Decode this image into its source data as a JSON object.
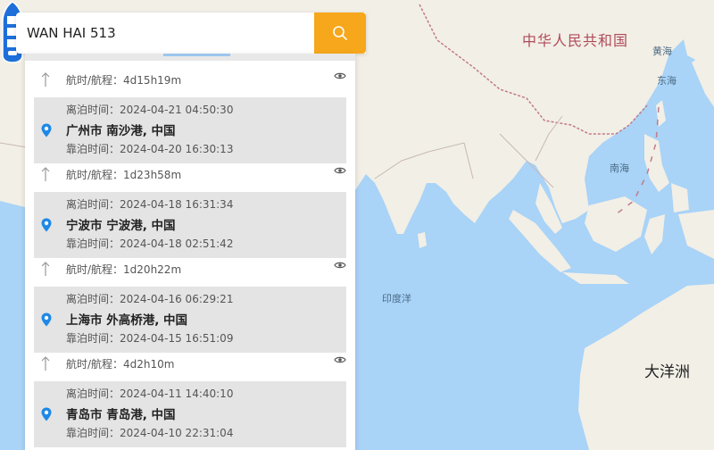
{
  "search": {
    "value": "WAN HAI 513"
  },
  "map": {
    "labels": {
      "country": "中华人民共和国",
      "yellow_sea": "黄海",
      "east_sea": "东海",
      "south_sea": "南海",
      "indian_ocean": "印度洋",
      "oceania": "大洋洲"
    }
  },
  "route": {
    "legs": [
      {
        "voyage": "航时/航程：4d15h19m",
        "departure": "离泊时间：2024-04-21 04:50:30",
        "port": "广州市 南沙港, 中国",
        "arrival": "靠泊时间：2024-04-20 16:30:13"
      },
      {
        "voyage": "航时/航程：1d23h58m",
        "departure": "离泊时间：2024-04-18 16:31:34",
        "port": "宁波市 宁波港, 中国",
        "arrival": "靠泊时间：2024-04-18 02:51:42"
      },
      {
        "voyage": "航时/航程：1d20h22m",
        "departure": "离泊时间：2024-04-16 06:29:21",
        "port": "上海市 外高桥港, 中国",
        "arrival": "靠泊时间：2024-04-15 16:51:09"
      },
      {
        "voyage": "航时/航程：4d2h10m",
        "departure": "离泊时间：2024-04-11 14:40:10",
        "port": "青岛市 青岛港, 中国",
        "arrival": "靠泊时间：2024-04-10 22:31:04"
      }
    ]
  },
  "colors": {
    "search_button": "#f7a71c",
    "pin": "#1e88e5",
    "ocean": "#a9d3f7",
    "land": "#f2efe6",
    "border": "#c07a8a"
  }
}
